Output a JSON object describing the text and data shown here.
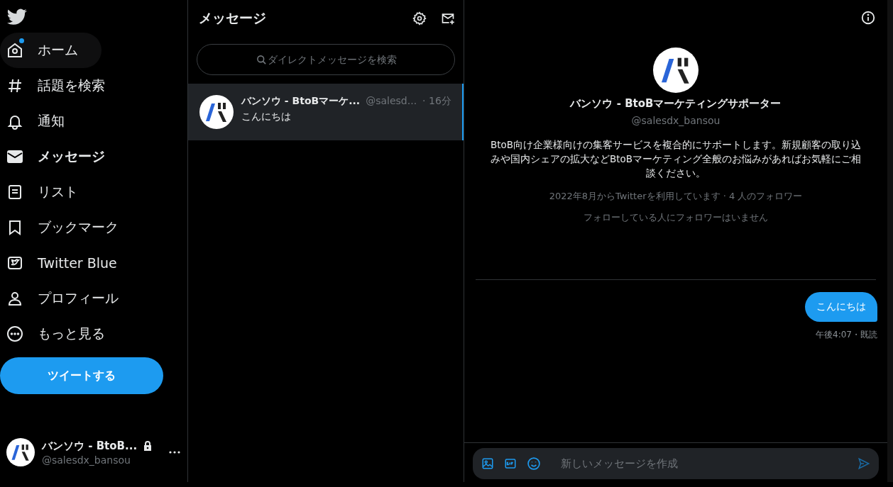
{
  "nav": {
    "items": [
      {
        "label": "ホーム",
        "selected": false,
        "highlighted": true,
        "badge": true
      },
      {
        "label": "話題を検索",
        "selected": false,
        "highlighted": false,
        "badge": false
      },
      {
        "label": "通知",
        "selected": false,
        "highlighted": false,
        "badge": false
      },
      {
        "label": "メッセージ",
        "selected": true,
        "highlighted": false,
        "badge": false
      },
      {
        "label": "リスト",
        "selected": false,
        "highlighted": false,
        "badge": false
      },
      {
        "label": "ブックマーク",
        "selected": false,
        "highlighted": false,
        "badge": false
      },
      {
        "label": "Twitter Blue",
        "selected": false,
        "highlighted": false,
        "badge": false
      },
      {
        "label": "プロフィール",
        "selected": false,
        "highlighted": false,
        "badge": false
      },
      {
        "label": "もっと見る",
        "selected": false,
        "highlighted": false,
        "badge": false
      }
    ],
    "tweet_button": "ツイートする",
    "account": {
      "name": "バンソウ - BtoB...",
      "handle": "@salesdx_bansou",
      "locked": true
    }
  },
  "messages": {
    "title": "メッセージ",
    "search": {
      "placeholder": "ダイレクトメッセージを検索"
    },
    "conversations": [
      {
        "name": "バンソウ - BtoBマーケ...",
        "handle": "@salesd...",
        "time": "· 16分",
        "preview": "こんにちは",
        "selected": true
      }
    ]
  },
  "conversation": {
    "profile": {
      "name": "バンソウ - BtoBマーケティングサポーター",
      "handle": "@salesdx_bansou",
      "bio": "BtoB向け企業様向けの集客サービスを複合的にサポートします。新規顧客の取り込みや国内シェアの拡大などBtoBマーケティング全般のお悩みがあればお気軽にご相談ください。",
      "meta": "2022年8月からTwitterを利用しています · 4 人のフォロワー",
      "followers_note": "フォローしている人にフォロワーはいません"
    },
    "messages": [
      {
        "text": "こんにちは",
        "meta": "午後4:07・既読"
      }
    ],
    "composer": {
      "placeholder": "新しいメッセージを作成"
    }
  }
}
